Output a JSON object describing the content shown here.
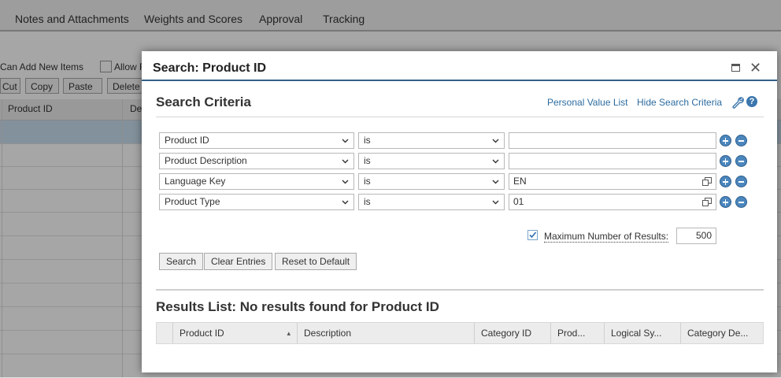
{
  "background": {
    "tabs": [
      "Notes and Attachments",
      "Weights and Scores",
      "Approval",
      "Tracking"
    ],
    "options": {
      "can_add_new_items": "Can Add New Items",
      "allow": "Allow F"
    },
    "toolbar": [
      "Cut",
      "Copy",
      "Paste",
      "Delete"
    ],
    "table_headers": [
      "Product ID",
      "De"
    ]
  },
  "dialog": {
    "title": "Search: Product ID",
    "criteria": {
      "title": "Search Criteria",
      "personal_value_list": "Personal Value List",
      "hide_search_criteria": "Hide Search Criteria",
      "rows": [
        {
          "field": "Product ID",
          "operator": "is",
          "value": "",
          "value_help": false
        },
        {
          "field": "Product Description",
          "operator": "is",
          "value": "",
          "value_help": false
        },
        {
          "field": "Language Key",
          "operator": "is",
          "value": "EN",
          "value_help": true
        },
        {
          "field": "Product Type",
          "operator": "is",
          "value": "01",
          "value_help": true
        }
      ],
      "max_results_label": "Maximum Number of Results:",
      "max_results_checked": true,
      "max_results_value": "500"
    },
    "buttons": {
      "search": "Search",
      "clear": "Clear Entries",
      "reset": "Reset to Default"
    },
    "results": {
      "title": "Results List: No results found for Product ID",
      "columns": [
        "Product ID",
        "Description",
        "Category ID",
        "Prod...",
        "Logical Sy...",
        "Category De..."
      ]
    }
  },
  "colors": {
    "accent": "#346187",
    "link": "#2c6ba0",
    "round_button": "#4b86bd"
  }
}
